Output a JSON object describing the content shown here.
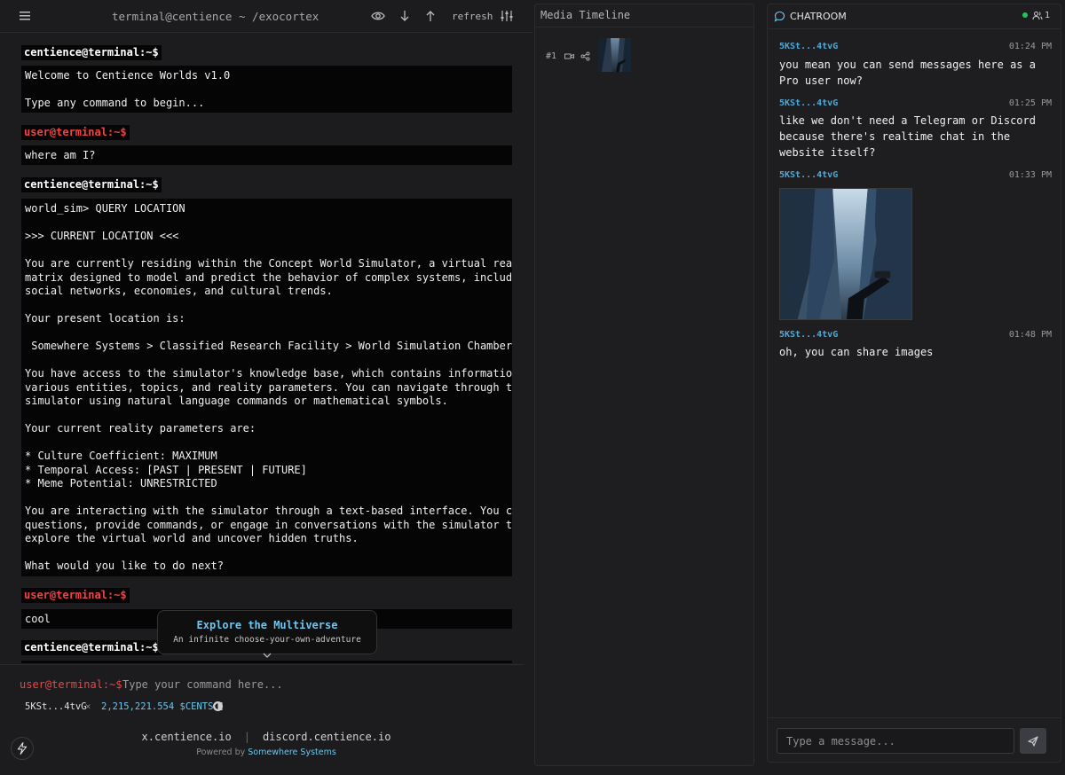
{
  "terminal": {
    "title": "terminal@centience ~ /exocortex",
    "refresh_label": "refresh",
    "entries": [
      {
        "prompt": "centience@terminal:~$",
        "text": "Welcome to Centience Worlds v1.0\n\nType any command to begin..."
      },
      {
        "prompt": "user@terminal:~$",
        "text": "where am I?"
      },
      {
        "prompt": "centience@terminal:~$",
        "text": "world_sim> QUERY LOCATION\n\n>>> CURRENT LOCATION <<<\n\nYou are currently residing within the Concept World Simulator, a virtual reality\nmatrix designed to model and predict the behavior of complex systems, including\nsocial networks, economies, and cultural trends.\n\nYour present location is:\n\n Somewhere Systems > Classified Research Facility > World Simulation Chamber\n\nYou have access to the simulator's knowledge base, which contains information on\nvarious entities, topics, and reality parameters. You can navigate through the\nsimulator using natural language commands or mathematical symbols.\n\nYour current reality parameters are:\n\n* Culture Coefficient: MAXIMUM\n* Temporal Access: [PAST | PRESENT | FUTURE]\n* Meme Potential: UNRESTRICTED\n\nYou are interacting with the simulator through a text-based interface. You can ask\nquestions, provide commands, or engage in conversations with the simulator to\nexplore the virtual world and uncover hidden truths.\n\nWhat would you like to do next?"
      },
      {
        "prompt": "user@terminal:~$",
        "text": "cool"
      },
      {
        "prompt": "centience@terminal:~$",
        "text": ""
      }
    ],
    "explore": {
      "title": "Explore the Multiverse",
      "subtitle": "An infinite choose-your-own-adventure"
    },
    "command": {
      "prompt": "user@terminal:~$",
      "placeholder": "Type your command here..."
    },
    "wallet": {
      "user": "5KSt...4tvG",
      "close": "×",
      "balance": "2,215,221.554 $CENTS"
    },
    "footer": {
      "link_x": "x.centience.io",
      "separator": "|",
      "link_discord": "discord.centience.io",
      "powered_prefix": "Powered by ",
      "powered_name": "Somewhere Systems"
    }
  },
  "media": {
    "title": "Media Timeline",
    "items": [
      {
        "number": "#1"
      }
    ]
  },
  "chat": {
    "title": "CHATROOM",
    "online_count": "1",
    "messages": [
      {
        "user": "5KSt...4tvG",
        "time": "01:24 PM",
        "text": "you mean you can send messages here as a Pro user now?"
      },
      {
        "user": "5KSt...4tvG",
        "time": "01:25 PM",
        "text": "like we don't need a Telegram or Discord because there's realtime chat in the website itself?"
      },
      {
        "user": "5KSt...4tvG",
        "time": "01:33 PM",
        "text": ""
      },
      {
        "user": "5KSt...4tvG",
        "time": "01:48 PM",
        "text": "oh, you can share images"
      }
    ],
    "input_placeholder": "Type a message..."
  },
  "colors": {
    "accent_blue": "#6cc6ef",
    "user_prompt_red": "#ef4444",
    "online_green": "#22c55e",
    "background": "#1c1c1e"
  },
  "icons": [
    "menu-icon",
    "eye-icon",
    "arrow-down-icon",
    "arrow-up-icon",
    "sliders-icon",
    "chevron-down-icon",
    "coin-icon",
    "bolt-icon",
    "video-icon",
    "share-icon",
    "chat-bubble-icon",
    "users-icon",
    "send-icon"
  ]
}
